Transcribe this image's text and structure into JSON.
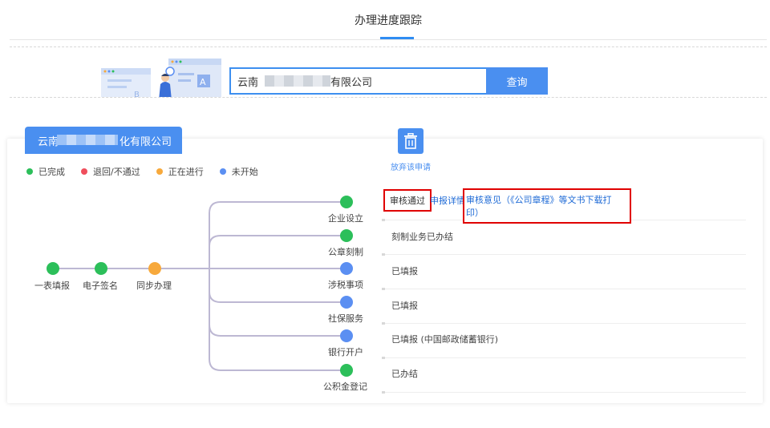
{
  "header": {
    "title": "办理进度跟踪"
  },
  "search": {
    "value_prefix": "云南",
    "value_suffix": "有限公司",
    "button": "查询"
  },
  "company_tab": {
    "prefix": "云南",
    "suffix": "化有限公司"
  },
  "legend": [
    {
      "label": "已完成",
      "color": "#2cbf5a"
    },
    {
      "label": "退回/不通过",
      "color": "#ef4e5c"
    },
    {
      "label": "正在进行",
      "color": "#f7a93c"
    },
    {
      "label": "未开始",
      "color": "#5b8ff2"
    }
  ],
  "main_steps": [
    {
      "label": "一表填报",
      "status": "completed"
    },
    {
      "label": "电子签名",
      "status": "completed"
    },
    {
      "label": "同步办理",
      "status": "in-progress"
    }
  ],
  "branches": [
    {
      "label": "企业设立",
      "status": "completed"
    },
    {
      "label": "公章刻制",
      "status": "completed"
    },
    {
      "label": "涉税事项",
      "status": "not-started"
    },
    {
      "label": "社保服务",
      "status": "not-started"
    },
    {
      "label": "银行开户",
      "status": "not-started"
    },
    {
      "label": "公积金登记",
      "status": "completed"
    }
  ],
  "abandon": {
    "label": "放弃该申请",
    "icon": "trash-icon"
  },
  "status_rows": {
    "approved": "审核通过",
    "detail_link": "申报详情",
    "opinion_link": "审核意见（《公司章程》等文书下载打印）",
    "seal": "刻制业务已办结",
    "tax": "已填报",
    "social": "已填报",
    "bank": "已填报 (中国邮政储蓄银行)",
    "fund": "已办结"
  },
  "colors": {
    "accent": "#4a8ff0",
    "completed": "#2cbf5a",
    "in_progress": "#f7a93c",
    "not_started": "#5b8ff2",
    "highlight_box": "#e00000"
  }
}
